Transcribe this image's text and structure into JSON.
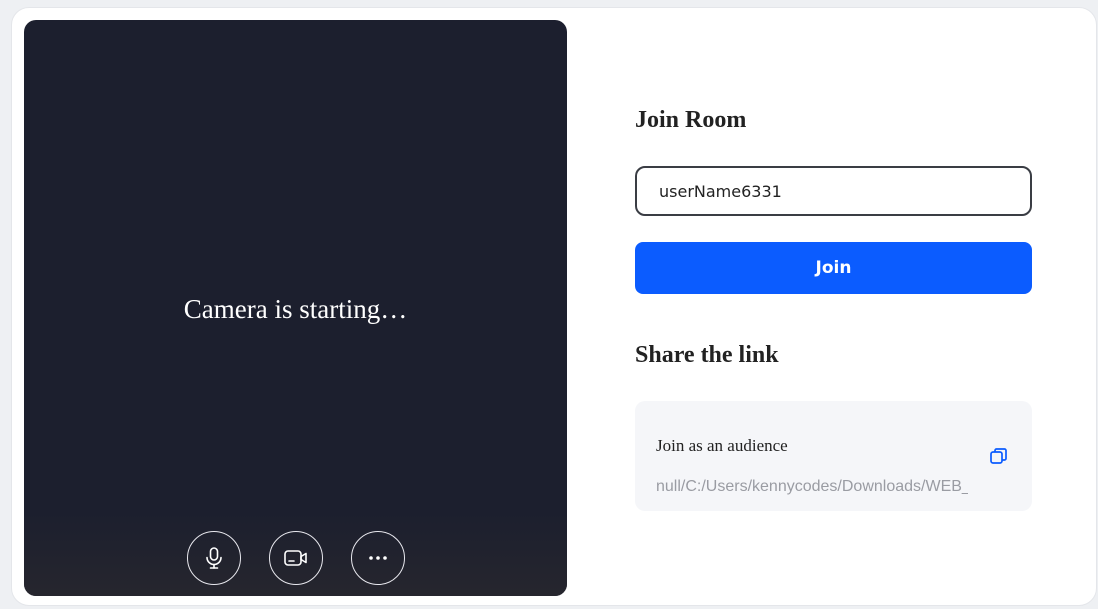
{
  "preview": {
    "status_text": "Camera is starting…"
  },
  "controls": {
    "icons": [
      "microphone-icon",
      "video-camera-icon",
      "more-icon"
    ]
  },
  "join": {
    "heading": "Join Room",
    "name_value": "userName6331",
    "button_label": "Join"
  },
  "share": {
    "heading": "Share the link",
    "label": "Join as an audience",
    "link": "null/C:/Users/kennycodes/Downloads/WEB_l"
  },
  "colors": {
    "preview_bg": "#1c1f2e",
    "accent": "#0b5cff",
    "share_box_bg": "#f5f6f9"
  }
}
